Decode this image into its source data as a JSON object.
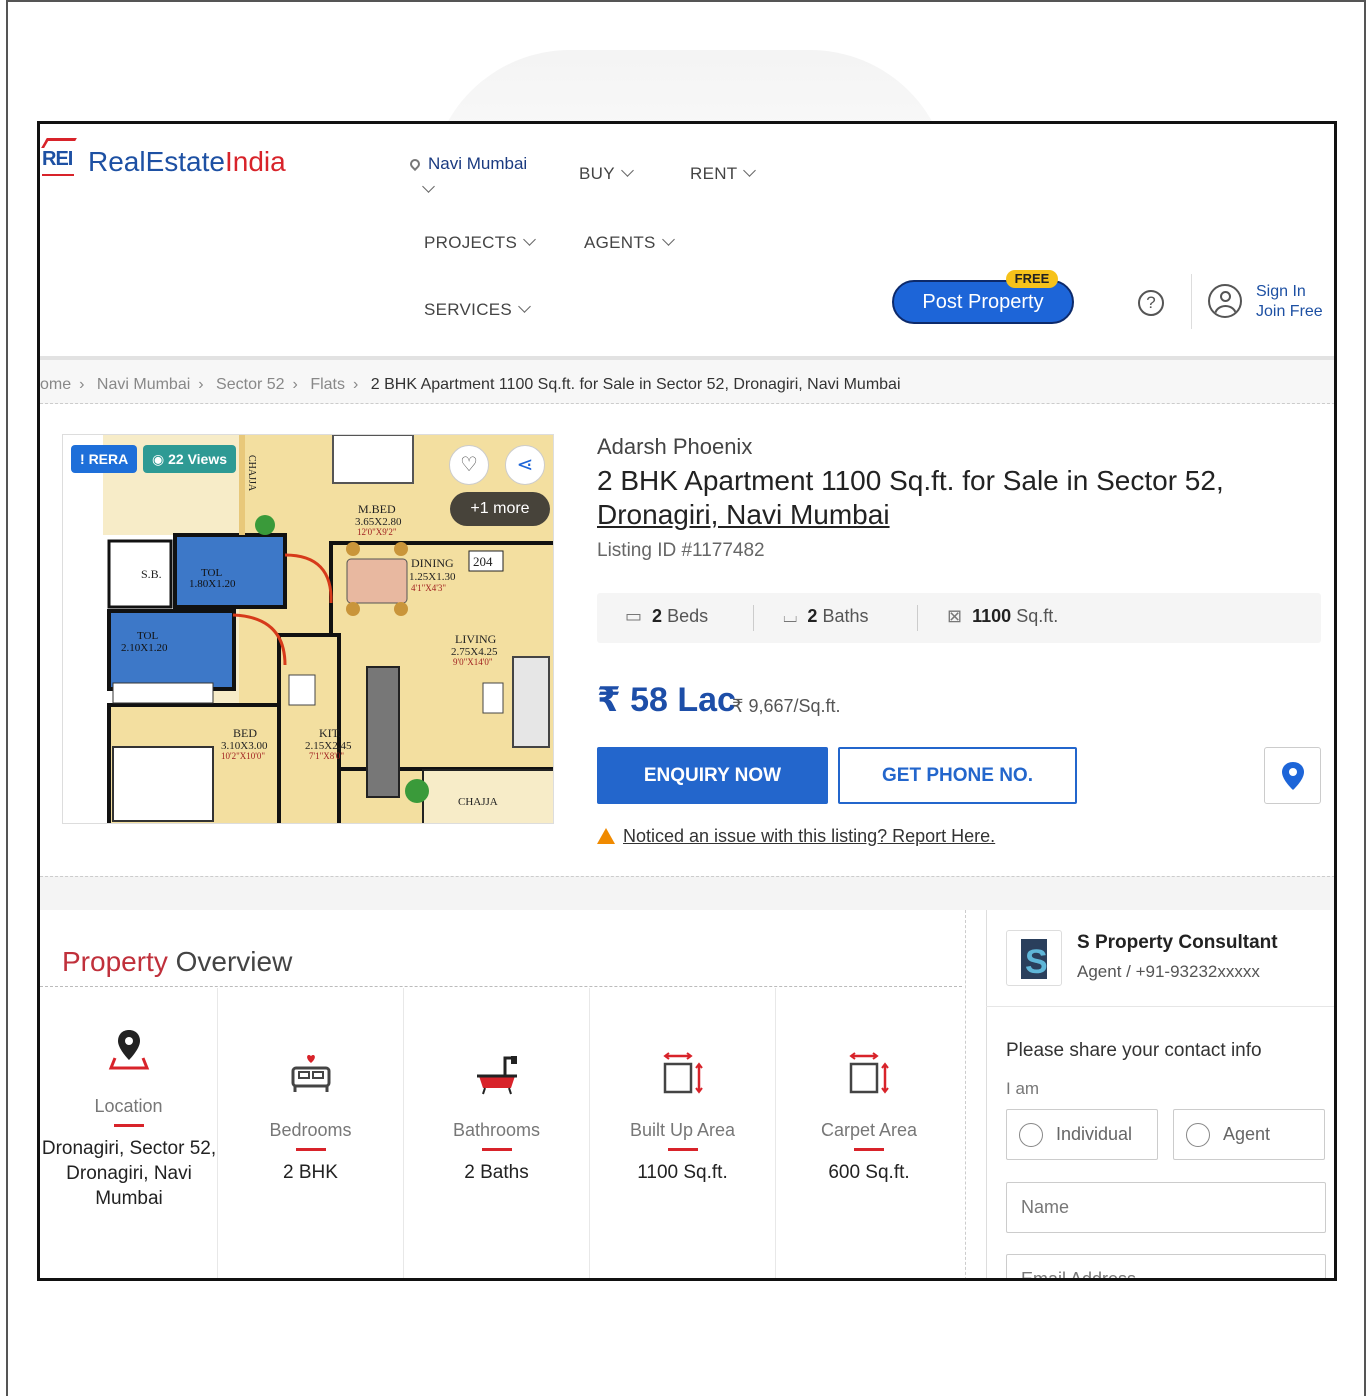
{
  "header": {
    "logo_short": "REI",
    "logo_part1": "RealEstate",
    "logo_part2": "India",
    "location": "Navi Mumbai",
    "nav": {
      "buy": "BUY",
      "rent": "RENT",
      "projects": "PROJECTS",
      "agents": "AGENTS",
      "services": "SERVICES"
    },
    "post_property": "Post Property",
    "free_badge": "FREE",
    "help": "?",
    "sign_in": "Sign In",
    "join_free": "Join Free"
  },
  "breadcrumb": {
    "items": [
      "ome",
      "Navi Mumbai",
      "Sector 52",
      "Flats"
    ],
    "current": "2 BHK Apartment 1100 Sq.ft. for Sale in Sector 52, Dronagiri, Navi Mumbai"
  },
  "gallery": {
    "rera_label": "RERA",
    "views_label": "22 Views",
    "more_label": "+1 more",
    "floorplan_labels": [
      "M.BED",
      "3.65X2.80",
      "12'0\"X9'2\"",
      "DINING",
      "1.25X1.30",
      "4'1\"X4'3\"",
      "204",
      "S.B.",
      "TOL",
      "1.80X1.20",
      "TOL",
      "2.10X1.20",
      "LIVING",
      "2.75X4.25",
      "9'0\"X14'0\"",
      "BED",
      "3.10X3.00",
      "10'2\"X10'0\"",
      "KIT.",
      "2.15X2.45",
      "7'1\"X8'0\"",
      "CHAJJA",
      "CHAJJA"
    ]
  },
  "listing": {
    "project": "Adarsh Phoenix",
    "title_line1": "2 BHK Apartment 1100 Sq.ft. for Sale in Sector 52,",
    "title_line2": "Dronagiri, Navi Mumbai",
    "listing_id": "Listing ID #1177482",
    "beds_num": "2",
    "beds_label": "Beds",
    "baths_num": "2",
    "baths_label": "Baths",
    "area_num": "1100",
    "area_label": "Sq.ft.",
    "price": "₹ 58 Lac",
    "price_per_sqft": "₹ 9,667/Sq.ft.",
    "enquiry": "ENQUIRY NOW",
    "get_phone": "GET PHONE NO.",
    "report": "Noticed an issue with this listing? Report Here."
  },
  "overview": {
    "title_part1": "Property ",
    "title_part2": "Overview",
    "cells": [
      {
        "label": "Location",
        "value": "Dronagiri, Sector 52, Dronagiri, Navi Mumbai",
        "icon": "location-pin-icon"
      },
      {
        "label": "Bedrooms",
        "value": "2 BHK",
        "icon": "bed-icon"
      },
      {
        "label": "Bathrooms",
        "value": "2 Baths",
        "icon": "bathtub-icon"
      },
      {
        "label": "Built Up Area",
        "value": "1100 Sq.ft.",
        "icon": "area-icon"
      },
      {
        "label": "Carpet Area",
        "value": "600 Sq.ft.",
        "icon": "area-icon"
      }
    ]
  },
  "agent": {
    "logo_letter": "S",
    "name": "S Property Consultant",
    "sub": "Agent / +91-93232xxxxx",
    "share_prompt": "Please share your contact info",
    "i_am": "I am",
    "opt_individual": "Individual",
    "opt_agent": "Agent",
    "name_placeholder": "Name",
    "email_placeholder": "Email Address"
  },
  "colors": {
    "brand_blue": "#1d50a3",
    "brand_red": "#d8232a",
    "button_blue": "#2366cc",
    "rera_blue": "#1e6fd9",
    "views_teal": "#2e9a94"
  }
}
